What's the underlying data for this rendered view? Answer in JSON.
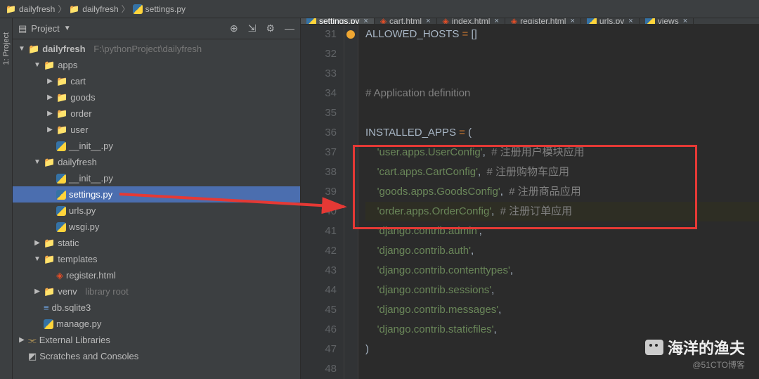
{
  "breadcrumb": {
    "root": "dailyfresh",
    "dir": "dailyfresh",
    "file": "settings.py"
  },
  "project": {
    "label": "Project",
    "sidebar": "1: Project",
    "root_name": "dailyfresh",
    "root_path": "F:\\pythonProject\\dailyfresh",
    "items": [
      {
        "d": 1,
        "a": "dn",
        "icon": "dir",
        "t": "apps"
      },
      {
        "d": 2,
        "a": "rt",
        "icon": "pydir",
        "t": "cart"
      },
      {
        "d": 2,
        "a": "rt",
        "icon": "pydir",
        "t": "goods"
      },
      {
        "d": 2,
        "a": "rt",
        "icon": "pydir",
        "t": "order"
      },
      {
        "d": 2,
        "a": "rt",
        "icon": "pydir",
        "t": "user"
      },
      {
        "d": 2,
        "a": "no",
        "icon": "py",
        "t": "__init__.py"
      },
      {
        "d": 1,
        "a": "dn",
        "icon": "pydir",
        "t": "dailyfresh"
      },
      {
        "d": 2,
        "a": "no",
        "icon": "py",
        "t": "__init__.py"
      },
      {
        "d": 2,
        "a": "no",
        "icon": "py",
        "t": "settings.py",
        "sel": true
      },
      {
        "d": 2,
        "a": "no",
        "icon": "py",
        "t": "urls.py"
      },
      {
        "d": 2,
        "a": "no",
        "icon": "py",
        "t": "wsgi.py"
      },
      {
        "d": 1,
        "a": "rt",
        "icon": "dir",
        "t": "static"
      },
      {
        "d": 1,
        "a": "dn",
        "icon": "dir",
        "t": "templates"
      },
      {
        "d": 2,
        "a": "no",
        "icon": "html",
        "t": "register.html"
      },
      {
        "d": 1,
        "a": "rt",
        "icon": "dir",
        "t": "venv",
        "dim": "library root"
      },
      {
        "d": 1,
        "a": "no",
        "icon": "sqlite",
        "t": "db.sqlite3"
      },
      {
        "d": 1,
        "a": "no",
        "icon": "py",
        "t": "manage.py"
      }
    ],
    "ext_lib": "External Libraries",
    "scratches": "Scratches and Consoles"
  },
  "tabs": [
    {
      "t": "settings.py",
      "icon": "py",
      "active": true
    },
    {
      "t": "cart.html",
      "icon": "html"
    },
    {
      "t": "index.html",
      "icon": "html"
    },
    {
      "t": "register.html",
      "icon": "html"
    },
    {
      "t": "urls.py",
      "icon": "py"
    },
    {
      "t": "views",
      "icon": "py"
    }
  ],
  "code": {
    "start": 31,
    "lines": [
      {
        "n": 31,
        "seg": [
          {
            "c": "n",
            "t": "ALLOWED_HOSTS "
          },
          {
            "c": "k",
            "t": "="
          },
          {
            "c": "n",
            "t": " []"
          }
        ]
      },
      {
        "n": 32,
        "seg": []
      },
      {
        "n": 33,
        "seg": []
      },
      {
        "n": 34,
        "seg": [
          {
            "c": "c",
            "t": "# Application definition"
          }
        ]
      },
      {
        "n": 35,
        "seg": []
      },
      {
        "n": 36,
        "seg": [
          {
            "c": "n",
            "t": "INSTALLED_APPS "
          },
          {
            "c": "k",
            "t": "="
          },
          {
            "c": "n",
            "t": " ("
          }
        ]
      },
      {
        "n": 37,
        "seg": [
          {
            "c": "n",
            "t": "    "
          },
          {
            "c": "s",
            "t": "'user.apps.UserConfig'"
          },
          {
            "c": "p",
            "t": ","
          },
          {
            "c": "n",
            "t": "  "
          },
          {
            "c": "c",
            "t": "# 注册用户模块应用"
          }
        ]
      },
      {
        "n": 38,
        "seg": [
          {
            "c": "n",
            "t": "    "
          },
          {
            "c": "s",
            "t": "'cart.apps.CartConfig'"
          },
          {
            "c": "p",
            "t": ","
          },
          {
            "c": "n",
            "t": "  "
          },
          {
            "c": "c",
            "t": "# 注册购物车应用"
          }
        ]
      },
      {
        "n": 39,
        "seg": [
          {
            "c": "n",
            "t": "    "
          },
          {
            "c": "s",
            "t": "'goods.apps.GoodsConfig'"
          },
          {
            "c": "p",
            "t": ","
          },
          {
            "c": "n",
            "t": "  "
          },
          {
            "c": "c",
            "t": "# 注册商品应用"
          }
        ]
      },
      {
        "n": 40,
        "seg": [
          {
            "c": "n",
            "t": "    "
          },
          {
            "c": "s",
            "t": "'order.apps.OrderConfig'"
          },
          {
            "c": "p",
            "t": ","
          },
          {
            "c": "n",
            "t": "  "
          },
          {
            "c": "c",
            "t": "# 注册订单应用"
          }
        ],
        "hl": true,
        "warn": true
      },
      {
        "n": 41,
        "seg": [
          {
            "c": "n",
            "t": "    "
          },
          {
            "c": "s",
            "t": "'django.contrib.admin'"
          },
          {
            "c": "p",
            "t": ","
          }
        ]
      },
      {
        "n": 42,
        "seg": [
          {
            "c": "n",
            "t": "    "
          },
          {
            "c": "s",
            "t": "'django.contrib.auth'"
          },
          {
            "c": "p",
            "t": ","
          }
        ]
      },
      {
        "n": 43,
        "seg": [
          {
            "c": "n",
            "t": "    "
          },
          {
            "c": "s",
            "t": "'django.contrib.contenttypes'"
          },
          {
            "c": "p",
            "t": ","
          }
        ]
      },
      {
        "n": 44,
        "seg": [
          {
            "c": "n",
            "t": "    "
          },
          {
            "c": "s",
            "t": "'django.contrib.sessions'"
          },
          {
            "c": "p",
            "t": ","
          }
        ]
      },
      {
        "n": 45,
        "seg": [
          {
            "c": "n",
            "t": "    "
          },
          {
            "c": "s",
            "t": "'django.contrib.messages'"
          },
          {
            "c": "p",
            "t": ","
          }
        ]
      },
      {
        "n": 46,
        "seg": [
          {
            "c": "n",
            "t": "    "
          },
          {
            "c": "s",
            "t": "'django.contrib.staticfiles'"
          },
          {
            "c": "p",
            "t": ","
          }
        ]
      },
      {
        "n": 47,
        "seg": [
          {
            "c": "n",
            "t": ")"
          }
        ]
      },
      {
        "n": 48,
        "seg": []
      }
    ]
  },
  "watermark": {
    "title": "海洋的渔夫",
    "sub": "@51CTO博客"
  }
}
